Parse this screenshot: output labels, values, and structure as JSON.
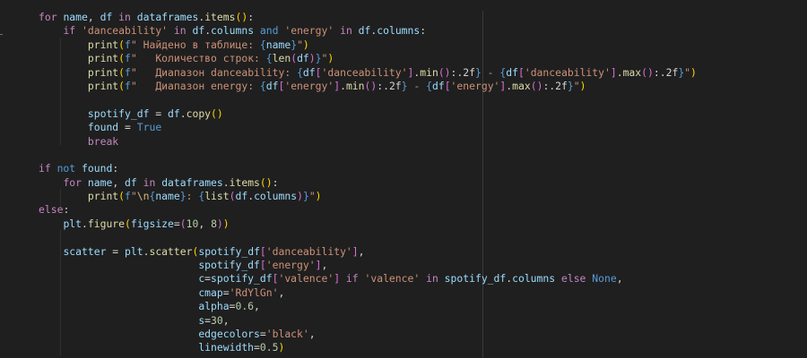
{
  "editor": {
    "theme_colors": {
      "background": "#1f1f1f",
      "keyword": "#569cd6",
      "control": "#c586c0",
      "function": "#dcdcaa",
      "variable": "#9cdcfe",
      "string": "#ce9178",
      "number": "#b5cea8",
      "escape": "#d7ba7d",
      "paren_level_1": "#ffd700",
      "paren_level_2": "#da70d6",
      "paren_level_3": "#179fff",
      "plain": "#d4d4d4"
    },
    "lines": [
      [
        [
          "control",
          "for"
        ],
        [
          "plain",
          " "
        ],
        [
          "variable",
          "name"
        ],
        [
          "plain",
          ", "
        ],
        [
          "variable",
          "df"
        ],
        [
          "plain",
          " "
        ],
        [
          "control",
          "in"
        ],
        [
          "plain",
          " "
        ],
        [
          "variable",
          "dataframes"
        ],
        [
          "plain",
          "."
        ],
        [
          "function",
          "items"
        ],
        [
          "paren-1",
          "()"
        ],
        [
          "plain",
          ":"
        ]
      ],
      [
        [
          "plain",
          "    "
        ],
        [
          "control",
          "if"
        ],
        [
          "plain",
          " "
        ],
        [
          "string",
          "'danceability'"
        ],
        [
          "plain",
          " "
        ],
        [
          "control",
          "in"
        ],
        [
          "plain",
          " "
        ],
        [
          "variable",
          "df"
        ],
        [
          "plain",
          "."
        ],
        [
          "variable",
          "columns"
        ],
        [
          "plain",
          " "
        ],
        [
          "keyword",
          "and"
        ],
        [
          "plain",
          " "
        ],
        [
          "string",
          "'energy'"
        ],
        [
          "plain",
          " "
        ],
        [
          "control",
          "in"
        ],
        [
          "plain",
          " "
        ],
        [
          "variable",
          "df"
        ],
        [
          "plain",
          "."
        ],
        [
          "variable",
          "columns"
        ],
        [
          "plain",
          ":"
        ]
      ],
      [
        [
          "plain",
          "        "
        ],
        [
          "function",
          "print"
        ],
        [
          "paren-1",
          "("
        ],
        [
          "keyword",
          "f"
        ],
        [
          "string",
          "\" Найдено в таблице: "
        ],
        [
          "keyword",
          "{"
        ],
        [
          "variable",
          "name"
        ],
        [
          "keyword",
          "}"
        ],
        [
          "string",
          "\""
        ],
        [
          "paren-1",
          ")"
        ]
      ],
      [
        [
          "plain",
          "        "
        ],
        [
          "function",
          "print"
        ],
        [
          "paren-1",
          "("
        ],
        [
          "keyword",
          "f"
        ],
        [
          "string",
          "\"   Количество строк: "
        ],
        [
          "keyword",
          "{"
        ],
        [
          "function",
          "len"
        ],
        [
          "paren-2",
          "("
        ],
        [
          "variable",
          "df"
        ],
        [
          "paren-2",
          ")"
        ],
        [
          "keyword",
          "}"
        ],
        [
          "string",
          "\""
        ],
        [
          "paren-1",
          ")"
        ]
      ],
      [
        [
          "plain",
          "        "
        ],
        [
          "function",
          "print"
        ],
        [
          "paren-1",
          "("
        ],
        [
          "keyword",
          "f"
        ],
        [
          "string",
          "\"   Диапазон danceability: "
        ],
        [
          "keyword",
          "{"
        ],
        [
          "variable",
          "df"
        ],
        [
          "paren-2",
          "["
        ],
        [
          "string",
          "'danceability'"
        ],
        [
          "paren-2",
          "]"
        ],
        [
          "plain",
          "."
        ],
        [
          "function",
          "min"
        ],
        [
          "paren-2",
          "()"
        ],
        [
          "plain",
          ":.2f"
        ],
        [
          "keyword",
          "}"
        ],
        [
          "string",
          " - "
        ],
        [
          "keyword",
          "{"
        ],
        [
          "variable",
          "df"
        ],
        [
          "paren-2",
          "["
        ],
        [
          "string",
          "'danceability'"
        ],
        [
          "paren-2",
          "]"
        ],
        [
          "plain",
          "."
        ],
        [
          "function",
          "max"
        ],
        [
          "paren-2",
          "()"
        ],
        [
          "plain",
          ":.2f"
        ],
        [
          "keyword",
          "}"
        ],
        [
          "string",
          "\""
        ],
        [
          "paren-1",
          ")"
        ]
      ],
      [
        [
          "plain",
          "        "
        ],
        [
          "function",
          "print"
        ],
        [
          "paren-1",
          "("
        ],
        [
          "keyword",
          "f"
        ],
        [
          "string",
          "\"   Диапазон energy: "
        ],
        [
          "keyword",
          "{"
        ],
        [
          "variable",
          "df"
        ],
        [
          "paren-2",
          "["
        ],
        [
          "string",
          "'energy'"
        ],
        [
          "paren-2",
          "]"
        ],
        [
          "plain",
          "."
        ],
        [
          "function",
          "min"
        ],
        [
          "paren-2",
          "()"
        ],
        [
          "plain",
          ":.2f"
        ],
        [
          "keyword",
          "}"
        ],
        [
          "string",
          " - "
        ],
        [
          "keyword",
          "{"
        ],
        [
          "variable",
          "df"
        ],
        [
          "paren-2",
          "["
        ],
        [
          "string",
          "'energy'"
        ],
        [
          "paren-2",
          "]"
        ],
        [
          "plain",
          "."
        ],
        [
          "function",
          "max"
        ],
        [
          "paren-2",
          "()"
        ],
        [
          "plain",
          ":.2f"
        ],
        [
          "keyword",
          "}"
        ],
        [
          "string",
          "\""
        ],
        [
          "paren-1",
          ")"
        ]
      ],
      [],
      [
        [
          "plain",
          "        "
        ],
        [
          "variable",
          "spotify_df"
        ],
        [
          "plain",
          " = "
        ],
        [
          "variable",
          "df"
        ],
        [
          "plain",
          "."
        ],
        [
          "function",
          "copy"
        ],
        [
          "paren-1",
          "()"
        ]
      ],
      [
        [
          "plain",
          "        "
        ],
        [
          "variable",
          "found"
        ],
        [
          "plain",
          " = "
        ],
        [
          "keyword",
          "True"
        ]
      ],
      [
        [
          "plain",
          "        "
        ],
        [
          "control",
          "break"
        ]
      ],
      [],
      [
        [
          "control",
          "if"
        ],
        [
          "plain",
          " "
        ],
        [
          "keyword",
          "not"
        ],
        [
          "plain",
          " "
        ],
        [
          "variable",
          "found"
        ],
        [
          "plain",
          ":"
        ]
      ],
      [
        [
          "plain",
          "    "
        ],
        [
          "control",
          "for"
        ],
        [
          "plain",
          " "
        ],
        [
          "variable",
          "name"
        ],
        [
          "plain",
          ", "
        ],
        [
          "variable",
          "df"
        ],
        [
          "plain",
          " "
        ],
        [
          "control",
          "in"
        ],
        [
          "plain",
          " "
        ],
        [
          "variable",
          "dataframes"
        ],
        [
          "plain",
          "."
        ],
        [
          "function",
          "items"
        ],
        [
          "paren-1",
          "()"
        ],
        [
          "plain",
          ":"
        ]
      ],
      [
        [
          "plain",
          "        "
        ],
        [
          "function",
          "print"
        ],
        [
          "paren-1",
          "("
        ],
        [
          "keyword",
          "f"
        ],
        [
          "string",
          "\""
        ],
        [
          "escape",
          "\\n"
        ],
        [
          "keyword",
          "{"
        ],
        [
          "variable",
          "name"
        ],
        [
          "keyword",
          "}"
        ],
        [
          "string",
          ": "
        ],
        [
          "keyword",
          "{"
        ],
        [
          "function",
          "list"
        ],
        [
          "paren-2",
          "("
        ],
        [
          "variable",
          "df"
        ],
        [
          "plain",
          "."
        ],
        [
          "variable",
          "columns"
        ],
        [
          "paren-2",
          ")"
        ],
        [
          "keyword",
          "}"
        ],
        [
          "string",
          "\""
        ],
        [
          "paren-1",
          ")"
        ]
      ],
      [
        [
          "control",
          "else"
        ],
        [
          "plain",
          ":"
        ]
      ],
      [
        [
          "plain",
          "    "
        ],
        [
          "variable",
          "plt"
        ],
        [
          "plain",
          "."
        ],
        [
          "function",
          "figure"
        ],
        [
          "paren-1",
          "("
        ],
        [
          "variable",
          "figsize"
        ],
        [
          "plain",
          "="
        ],
        [
          "paren-2",
          "("
        ],
        [
          "number",
          "10"
        ],
        [
          "plain",
          ", "
        ],
        [
          "number",
          "8"
        ],
        [
          "paren-2",
          ")"
        ],
        [
          "paren-1",
          ")"
        ]
      ],
      [],
      [
        [
          "plain",
          "    "
        ],
        [
          "variable",
          "scatter"
        ],
        [
          "plain",
          " = "
        ],
        [
          "variable",
          "plt"
        ],
        [
          "plain",
          "."
        ],
        [
          "function",
          "scatter"
        ],
        [
          "paren-1",
          "("
        ],
        [
          "variable",
          "spotify_df"
        ],
        [
          "paren-2",
          "["
        ],
        [
          "string",
          "'danceability'"
        ],
        [
          "paren-2",
          "]"
        ],
        [
          "plain",
          ","
        ]
      ],
      [
        [
          "plain",
          "                          "
        ],
        [
          "variable",
          "spotify_df"
        ],
        [
          "paren-2",
          "["
        ],
        [
          "string",
          "'energy'"
        ],
        [
          "paren-2",
          "]"
        ],
        [
          "plain",
          ","
        ]
      ],
      [
        [
          "plain",
          "                          "
        ],
        [
          "variable",
          "c"
        ],
        [
          "plain",
          "="
        ],
        [
          "variable",
          "spotify_df"
        ],
        [
          "paren-2",
          "["
        ],
        [
          "string",
          "'valence'"
        ],
        [
          "paren-2",
          "]"
        ],
        [
          "plain",
          " "
        ],
        [
          "control",
          "if"
        ],
        [
          "plain",
          " "
        ],
        [
          "string",
          "'valence'"
        ],
        [
          "plain",
          " "
        ],
        [
          "control",
          "in"
        ],
        [
          "plain",
          " "
        ],
        [
          "variable",
          "spotify_df"
        ],
        [
          "plain",
          "."
        ],
        [
          "variable",
          "columns"
        ],
        [
          "plain",
          " "
        ],
        [
          "control",
          "else"
        ],
        [
          "plain",
          " "
        ],
        [
          "keyword",
          "None"
        ],
        [
          "plain",
          ","
        ]
      ],
      [
        [
          "plain",
          "                          "
        ],
        [
          "variable",
          "cmap"
        ],
        [
          "plain",
          "="
        ],
        [
          "string",
          "'RdYlGn'"
        ],
        [
          "plain",
          ","
        ]
      ],
      [
        [
          "plain",
          "                          "
        ],
        [
          "variable",
          "alpha"
        ],
        [
          "plain",
          "="
        ],
        [
          "number",
          "0.6"
        ],
        [
          "plain",
          ","
        ]
      ],
      [
        [
          "plain",
          "                          "
        ],
        [
          "variable",
          "s"
        ],
        [
          "plain",
          "="
        ],
        [
          "number",
          "30"
        ],
        [
          "plain",
          ","
        ]
      ],
      [
        [
          "plain",
          "                          "
        ],
        [
          "variable",
          "edgecolors"
        ],
        [
          "plain",
          "="
        ],
        [
          "string",
          "'black'"
        ],
        [
          "plain",
          ","
        ]
      ],
      [
        [
          "plain",
          "                          "
        ],
        [
          "variable",
          "linewidth"
        ],
        [
          "plain",
          "="
        ],
        [
          "number",
          "0.5"
        ],
        [
          "paren-1",
          ")"
        ]
      ]
    ]
  }
}
